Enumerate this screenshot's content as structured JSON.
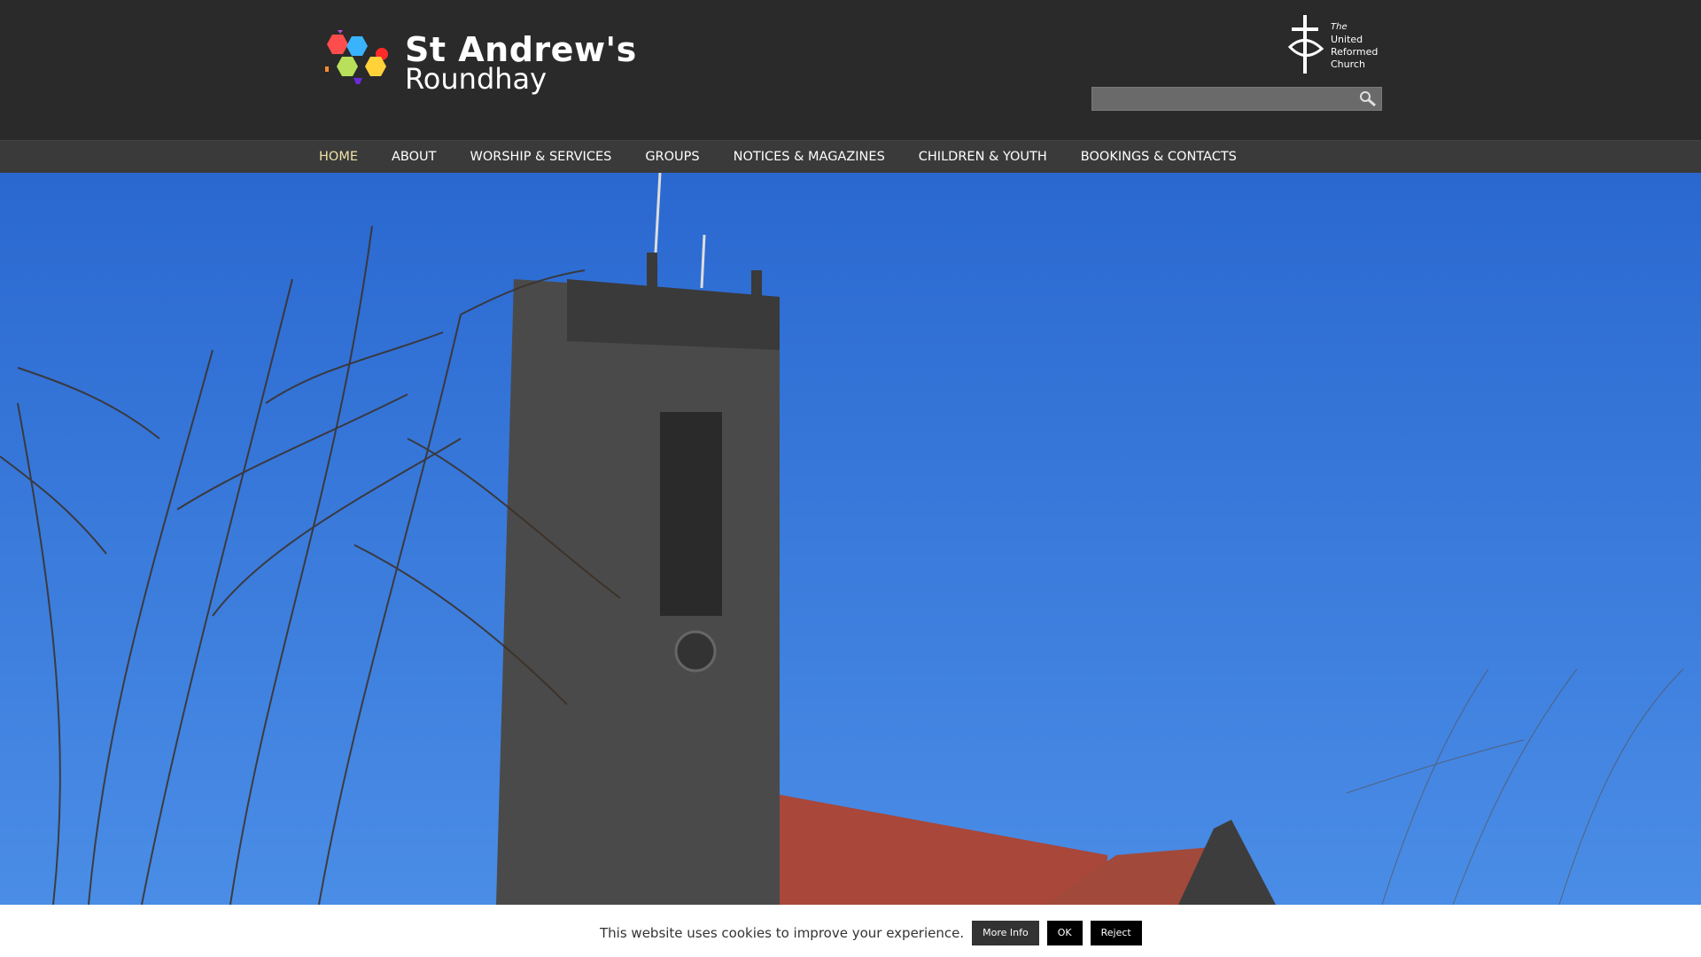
{
  "header": {
    "brand_name": "St Andrew's",
    "brand_sub": "Roundhay",
    "urc_logo": {
      "line1": "The",
      "line2": "United",
      "line3": "Reformed",
      "line4": "Church"
    },
    "search": {
      "placeholder": "",
      "value": "",
      "icon": "search-icon"
    }
  },
  "nav": {
    "items": [
      {
        "label": "HOME",
        "active": true
      },
      {
        "label": "ABOUT"
      },
      {
        "label": "WORSHIP & SERVICES"
      },
      {
        "label": "GROUPS"
      },
      {
        "label": "NOTICES & MAGAZINES"
      },
      {
        "label": "CHILDREN & YOUTH"
      },
      {
        "label": "BOOKINGS & CONTACTS"
      }
    ]
  },
  "cookie": {
    "message": "This website uses cookies to improve your experience.",
    "more_info": "More Info",
    "ok": "OK",
    "reject": "Reject"
  },
  "colors": {
    "header_bg": "#2a2a2a",
    "nav_bg": "#3a3a3a",
    "nav_active": "#f0e2a8",
    "sky": "#3a7fe0"
  }
}
